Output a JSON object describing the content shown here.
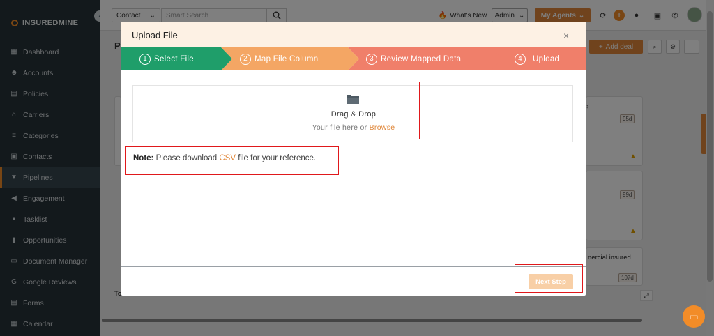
{
  "sidebar": {
    "logo": "INSUREDMINE",
    "collapse_icon": "‹",
    "items": [
      {
        "label": "Dashboard",
        "icon": "▦"
      },
      {
        "label": "Accounts",
        "icon": "☻"
      },
      {
        "label": "Policies",
        "icon": "▤"
      },
      {
        "label": "Carriers",
        "icon": "⌂"
      },
      {
        "label": "Categories",
        "icon": "≡"
      },
      {
        "label": "Contacts",
        "icon": "▣"
      },
      {
        "label": "Pipelines",
        "icon": "▼"
      },
      {
        "label": "Engagement",
        "icon": "◀"
      },
      {
        "label": "Tasklist",
        "icon": "▪"
      },
      {
        "label": "Opportunities",
        "icon": "▮"
      },
      {
        "label": "Document Manager",
        "icon": "▭"
      },
      {
        "label": "Google Reviews",
        "icon": "G"
      },
      {
        "label": "Forms",
        "icon": "▤"
      },
      {
        "label": "Calendar",
        "icon": "▦"
      }
    ],
    "active_index": 6
  },
  "topbar": {
    "contact_select": "Contact",
    "search_placeholder": "Smart Search",
    "whats_new": "What's New",
    "admin_select": "Admin",
    "agents_button": "My Agents",
    "chevron": "⌄"
  },
  "page": {
    "title_partial": "Pi",
    "add_deal": "Add deal",
    "cards": [
      {
        "days": "95d"
      },
      {
        "days": "99d"
      },
      {
        "days": "107d",
        "text": "nercial insured"
      }
    ],
    "card_text_top": "3",
    "footer_label_partial": "To"
  },
  "modal": {
    "title": "Upload File",
    "close": "×",
    "steps": [
      {
        "num": "1",
        "label": "Select File",
        "color": "#1f9e6a"
      },
      {
        "num": "2",
        "label": "Map File Column",
        "color": "#f4a664"
      },
      {
        "num": "3",
        "label": "Review Mapped Data",
        "color": "#f07f6a"
      },
      {
        "num": "4",
        "label": "Upload",
        "color": "#f07f6a"
      }
    ],
    "dropzone": {
      "title": "Drag & Drop",
      "sub_prefix": "Your file here or ",
      "browse": "Browse"
    },
    "note": {
      "bold": "Note:",
      "prefix": " Please download ",
      "csv": "CSV",
      "suffix": " file for your reference."
    },
    "next_button": "Next Step"
  },
  "colors": {
    "accent": "#e0873a",
    "sidebar_bg": "#263238",
    "annotation": "#e0181b"
  }
}
